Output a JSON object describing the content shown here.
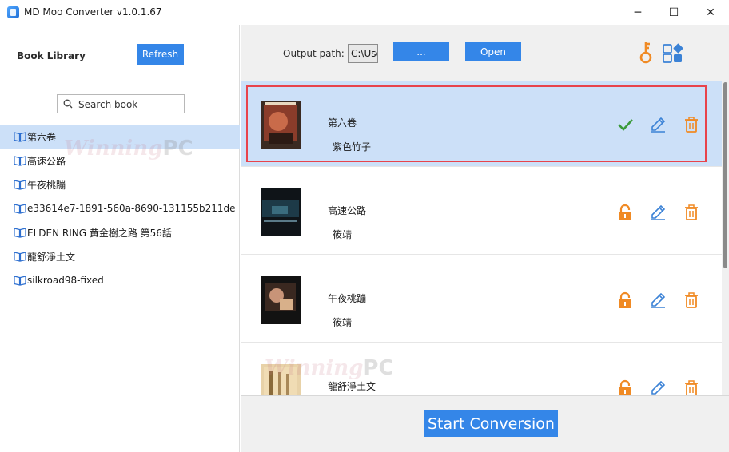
{
  "window": {
    "title": "MD Moo Converter v1.0.1.67",
    "minimize": "─",
    "maximize": "☐",
    "close": "✕"
  },
  "sidebar": {
    "title": "Book Library",
    "refresh_label": "Refresh",
    "search_placeholder": "Search book",
    "items": [
      {
        "label": "第六卷",
        "selected": true
      },
      {
        "label": "高速公路",
        "selected": false
      },
      {
        "label": "午夜桃蹦",
        "selected": false
      },
      {
        "label": "e33614e7-1891-560a-8690-131155b211de",
        "selected": false
      },
      {
        "label": "ELDEN RING 黄金樹之路 第56話",
        "selected": false
      },
      {
        "label": "龍舒淨土文",
        "selected": false
      },
      {
        "label": "silkroad98-fixed",
        "selected": false
      }
    ]
  },
  "toolbar": {
    "output_label": "Output path:",
    "output_value": "C:\\Use",
    "browse_label": "...",
    "open_label": "Open"
  },
  "books": [
    {
      "title": "第六卷",
      "author": "紫色竹子",
      "status": "converted",
      "status_icon": "check-icon",
      "active": true
    },
    {
      "title": "高速公路",
      "author": "筱靖",
      "status": "locked",
      "status_icon": "lock-icon",
      "active": false
    },
    {
      "title": "午夜桃蹦",
      "author": "筱靖",
      "status": "locked",
      "status_icon": "lock-icon",
      "active": false
    },
    {
      "title": "龍舒淨土文",
      "author": "",
      "status": "locked",
      "status_icon": "lock-icon",
      "active": false
    }
  ],
  "bottom": {
    "start_label": "Start Conversion"
  },
  "watermark": {
    "script": "Winning",
    "suffix": "PC"
  },
  "colors": {
    "accent": "#3486e8",
    "selection": "#cce0f8",
    "highlight_border": "#e8434b",
    "orange": "#f08a24",
    "green": "#3a9a3a",
    "edit_blue": "#3b82d6"
  }
}
